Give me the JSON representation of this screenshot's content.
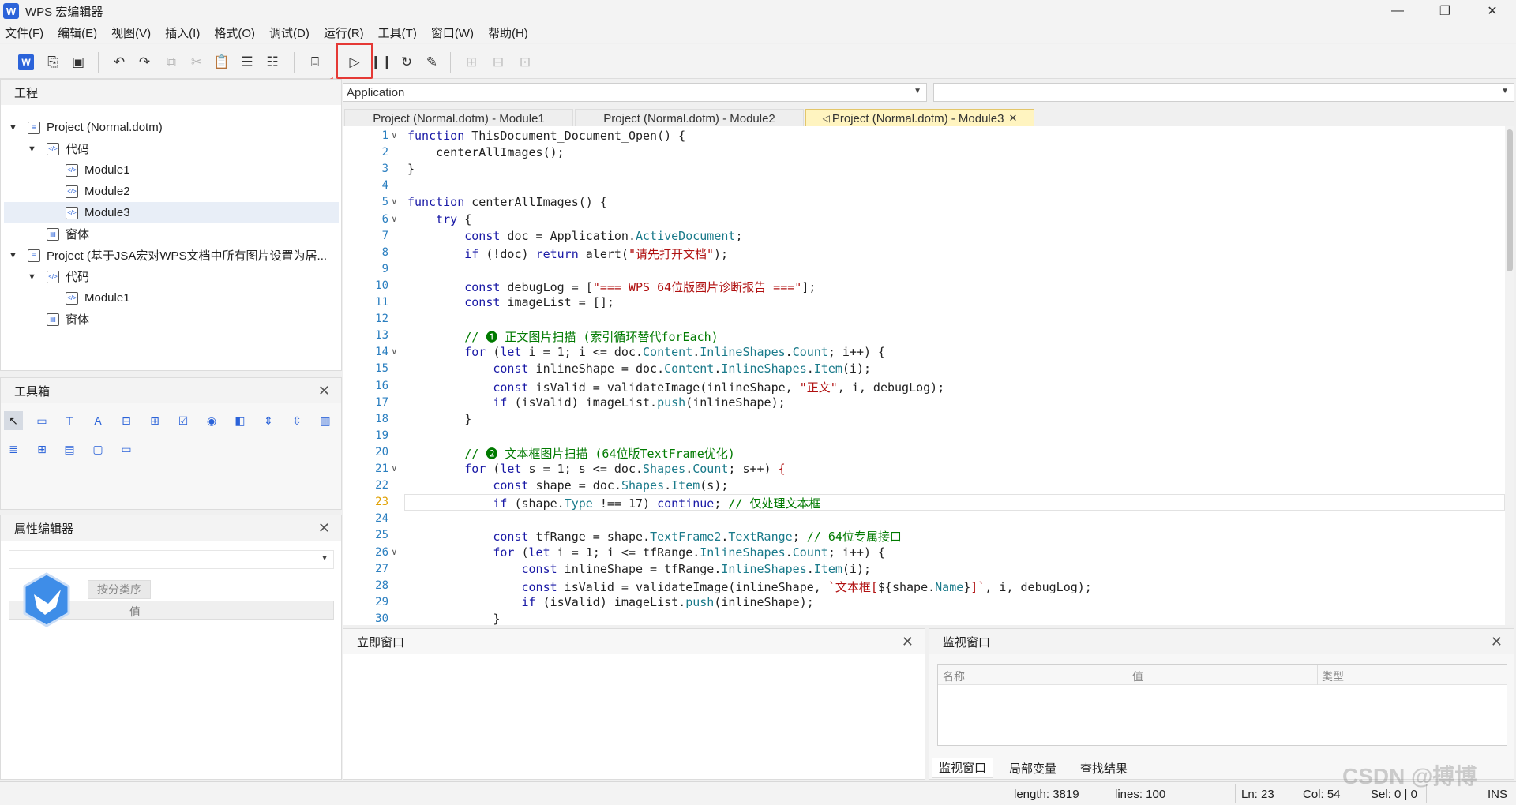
{
  "window": {
    "title": "WPS 宏编辑器",
    "logo": "W",
    "minimize_icon": "—",
    "maximize_icon": "❐",
    "close_icon": "✕"
  },
  "menu": [
    "文件(F)",
    "编辑(E)",
    "视图(V)",
    "插入(I)",
    "格式(O)",
    "调试(D)",
    "运行(R)",
    "工具(T)",
    "窗口(W)",
    "帮助(H)"
  ],
  "toolbar": {
    "icons": [
      "wps-icon",
      "save-as-icon",
      "save-icon",
      "undo-icon",
      "redo-icon",
      "copy-icon",
      "cut-icon",
      "paste-icon",
      "indent-icon",
      "outdent-icon",
      "toolbox-icon",
      "run-icon",
      "pause-icon",
      "reset-icon",
      "debug-icon",
      "step-into-icon",
      "step-over-icon",
      "step-out-icon"
    ],
    "highlight_color": "#e53935"
  },
  "project_panel": {
    "title": "工程",
    "close": "✕",
    "tree": [
      {
        "label": "Project (Normal.dotm)",
        "level": 0
      },
      {
        "label": "代码",
        "level": 1
      },
      {
        "label": "Module1",
        "level": 2
      },
      {
        "label": "Module2",
        "level": 2
      },
      {
        "label": "Module3",
        "level": 2
      },
      {
        "label": "窗体",
        "level": 1
      },
      {
        "label": "Project (基于JSA宏对WPS文档中所有图片设置为居...",
        "level": 0
      },
      {
        "label": "代码",
        "level": 1
      },
      {
        "label": "Module1",
        "level": 2
      },
      {
        "label": "窗体",
        "level": 1
      }
    ]
  },
  "toolbox_panel": {
    "title": "工具箱",
    "close": "✕"
  },
  "property_panel": {
    "title": "属性编辑器",
    "close": "✕",
    "sort_tab": "按分类序",
    "value_header": "值"
  },
  "editor": {
    "object_combo": "Application",
    "proc_combo": "",
    "tabs": [
      {
        "label": "Project (Normal.dotm) - Module1"
      },
      {
        "label": "Project (Normal.dotm) - Module2"
      },
      {
        "label": "Project (Normal.dotm) - Module3",
        "close": "✕"
      }
    ],
    "lines": [
      {
        "n": "1",
        "html": "<span class='kw'>function</span> ThisDocument_Document_Open() {"
      },
      {
        "n": "2",
        "html": "    centerAllImages();"
      },
      {
        "n": "3",
        "html": "}"
      },
      {
        "n": "4",
        "html": ""
      },
      {
        "n": "5",
        "html": "<span class='kw'>function</span> centerAllImages() {"
      },
      {
        "n": "6",
        "html": "    <span class='kw'>try</span> {"
      },
      {
        "n": "7",
        "html": "        <span class='kw'>const</span> doc = Application.<span class='prop'>ActiveDocument</span>;"
      },
      {
        "n": "8",
        "html": "        <span class='kw'>if</span> (!doc) <span class='kw'>return</span> alert(<span class='str'>\"请先打开文档\"</span>);"
      },
      {
        "n": "9",
        "html": ""
      },
      {
        "n": "10",
        "html": "        <span class='kw'>const</span> debugLog = [<span class='str'>\"=== WPS 64位版图片诊断报告 ===\"</span>];"
      },
      {
        "n": "11",
        "html": "        <span class='kw'>const</span> imageList = [];"
      },
      {
        "n": "12",
        "html": ""
      },
      {
        "n": "13",
        "html": "        <span class='cm'>// ❶ 正文图片扫描 (索引循环替代forEach)</span>"
      },
      {
        "n": "14",
        "html": "        <span class='kw'>for</span> (<span class='kw'>let</span> i = 1; i &lt;= doc.<span class='prop'>Content</span>.<span class='prop'>InlineShapes</span>.<span class='prop'>Count</span>; i++) {"
      },
      {
        "n": "15",
        "html": "            <span class='kw'>const</span> inlineShape = doc.<span class='prop'>Content</span>.<span class='prop'>InlineShapes</span>.<span class='prop'>Item</span>(i);"
      },
      {
        "n": "16",
        "html": "            <span class='kw'>const</span> isValid = validateImage(inlineShape, <span class='str'>\"正文\"</span>, i, debugLog);"
      },
      {
        "n": "17",
        "html": "            <span class='kw'>if</span> (isValid) imageList.<span class='prop'>push</span>(inlineShape);"
      },
      {
        "n": "18",
        "html": "        }"
      },
      {
        "n": "19",
        "html": ""
      },
      {
        "n": "20",
        "html": "        <span class='cm'>// ❷ 文本框图片扫描 (64位版TextFrame优化)</span>"
      },
      {
        "n": "21",
        "html": "        <span class='kw'>for</span> (<span class='kw'>let</span> s = 1; s &lt;= doc.<span class='prop'>Shapes</span>.<span class='prop'>Count</span>; s++) <span class='str'>{</span>"
      },
      {
        "n": "22",
        "html": "            <span class='kw'>const</span> shape = doc.<span class='prop'>Shapes</span>.<span class='prop'>Item</span>(s);"
      },
      {
        "n": "23",
        "html": "            <span class='kw'>if</span> (shape.<span class='prop'>Type</span> !== 17) <span class='kw'>continue</span>; <span class='cm'>// 仅处理文本框</span>"
      },
      {
        "n": "24",
        "html": ""
      },
      {
        "n": "25",
        "html": "            <span class='kw'>const</span> tfRange = shape.<span class='prop'>TextFrame2</span>.<span class='prop'>TextRange</span>; <span class='cm'>// 64位专属接口</span>"
      },
      {
        "n": "26",
        "html": "            <span class='kw'>for</span> (<span class='kw'>let</span> i = 1; i &lt;= tfRange.<span class='prop'>InlineShapes</span>.<span class='prop'>Count</span>; i++) {"
      },
      {
        "n": "27",
        "html": "                <span class='kw'>const</span> inlineShape = tfRange.<span class='prop'>InlineShapes</span>.<span class='prop'>Item</span>(i);"
      },
      {
        "n": "28",
        "html": "                <span class='kw'>const</span> isValid = validateImage(inlineShape, <span class='str'>`文本框[</span>${shape.<span class='prop'>Name</span>}<span class='str'>]`</span>, i, debugLog);"
      },
      {
        "n": "29",
        "html": "                <span class='kw'>if</span> (isValid) imageList.<span class='prop'>push</span>(inlineShape);"
      },
      {
        "n": "30",
        "html": "            }"
      }
    ],
    "current_line": "23"
  },
  "immediate_panel": {
    "title": "立即窗口",
    "close": "✕"
  },
  "watch_panel": {
    "title": "监视窗口",
    "close": "✕",
    "columns": [
      "名称",
      "值",
      "类型"
    ],
    "tabs": [
      "监视窗口",
      "局部变量",
      "查找结果"
    ]
  },
  "status": {
    "length": "length: 3819",
    "lines": "lines: 100",
    "ln": "Ln: 23",
    "col": "Col: 54",
    "sel": "Sel: 0 | 0",
    "mode": "INS"
  },
  "watermark": "CSDN @搏博"
}
